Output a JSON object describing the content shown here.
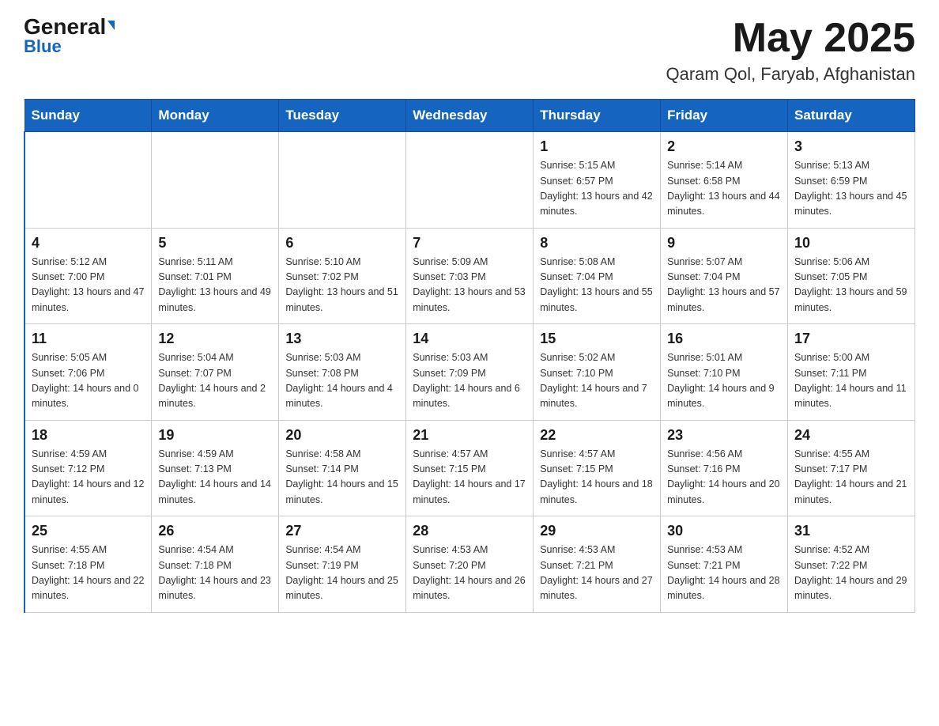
{
  "header": {
    "logo_general": "General",
    "logo_blue": "Blue",
    "month_year": "May 2025",
    "location": "Qaram Qol, Faryab, Afghanistan"
  },
  "days_of_week": [
    "Sunday",
    "Monday",
    "Tuesday",
    "Wednesday",
    "Thursday",
    "Friday",
    "Saturday"
  ],
  "weeks": [
    [
      {
        "day": "",
        "info": ""
      },
      {
        "day": "",
        "info": ""
      },
      {
        "day": "",
        "info": ""
      },
      {
        "day": "",
        "info": ""
      },
      {
        "day": "1",
        "info": "Sunrise: 5:15 AM\nSunset: 6:57 PM\nDaylight: 13 hours and 42 minutes."
      },
      {
        "day": "2",
        "info": "Sunrise: 5:14 AM\nSunset: 6:58 PM\nDaylight: 13 hours and 44 minutes."
      },
      {
        "day": "3",
        "info": "Sunrise: 5:13 AM\nSunset: 6:59 PM\nDaylight: 13 hours and 45 minutes."
      }
    ],
    [
      {
        "day": "4",
        "info": "Sunrise: 5:12 AM\nSunset: 7:00 PM\nDaylight: 13 hours and 47 minutes."
      },
      {
        "day": "5",
        "info": "Sunrise: 5:11 AM\nSunset: 7:01 PM\nDaylight: 13 hours and 49 minutes."
      },
      {
        "day": "6",
        "info": "Sunrise: 5:10 AM\nSunset: 7:02 PM\nDaylight: 13 hours and 51 minutes."
      },
      {
        "day": "7",
        "info": "Sunrise: 5:09 AM\nSunset: 7:03 PM\nDaylight: 13 hours and 53 minutes."
      },
      {
        "day": "8",
        "info": "Sunrise: 5:08 AM\nSunset: 7:04 PM\nDaylight: 13 hours and 55 minutes."
      },
      {
        "day": "9",
        "info": "Sunrise: 5:07 AM\nSunset: 7:04 PM\nDaylight: 13 hours and 57 minutes."
      },
      {
        "day": "10",
        "info": "Sunrise: 5:06 AM\nSunset: 7:05 PM\nDaylight: 13 hours and 59 minutes."
      }
    ],
    [
      {
        "day": "11",
        "info": "Sunrise: 5:05 AM\nSunset: 7:06 PM\nDaylight: 14 hours and 0 minutes."
      },
      {
        "day": "12",
        "info": "Sunrise: 5:04 AM\nSunset: 7:07 PM\nDaylight: 14 hours and 2 minutes."
      },
      {
        "day": "13",
        "info": "Sunrise: 5:03 AM\nSunset: 7:08 PM\nDaylight: 14 hours and 4 minutes."
      },
      {
        "day": "14",
        "info": "Sunrise: 5:03 AM\nSunset: 7:09 PM\nDaylight: 14 hours and 6 minutes."
      },
      {
        "day": "15",
        "info": "Sunrise: 5:02 AM\nSunset: 7:10 PM\nDaylight: 14 hours and 7 minutes."
      },
      {
        "day": "16",
        "info": "Sunrise: 5:01 AM\nSunset: 7:10 PM\nDaylight: 14 hours and 9 minutes."
      },
      {
        "day": "17",
        "info": "Sunrise: 5:00 AM\nSunset: 7:11 PM\nDaylight: 14 hours and 11 minutes."
      }
    ],
    [
      {
        "day": "18",
        "info": "Sunrise: 4:59 AM\nSunset: 7:12 PM\nDaylight: 14 hours and 12 minutes."
      },
      {
        "day": "19",
        "info": "Sunrise: 4:59 AM\nSunset: 7:13 PM\nDaylight: 14 hours and 14 minutes."
      },
      {
        "day": "20",
        "info": "Sunrise: 4:58 AM\nSunset: 7:14 PM\nDaylight: 14 hours and 15 minutes."
      },
      {
        "day": "21",
        "info": "Sunrise: 4:57 AM\nSunset: 7:15 PM\nDaylight: 14 hours and 17 minutes."
      },
      {
        "day": "22",
        "info": "Sunrise: 4:57 AM\nSunset: 7:15 PM\nDaylight: 14 hours and 18 minutes."
      },
      {
        "day": "23",
        "info": "Sunrise: 4:56 AM\nSunset: 7:16 PM\nDaylight: 14 hours and 20 minutes."
      },
      {
        "day": "24",
        "info": "Sunrise: 4:55 AM\nSunset: 7:17 PM\nDaylight: 14 hours and 21 minutes."
      }
    ],
    [
      {
        "day": "25",
        "info": "Sunrise: 4:55 AM\nSunset: 7:18 PM\nDaylight: 14 hours and 22 minutes."
      },
      {
        "day": "26",
        "info": "Sunrise: 4:54 AM\nSunset: 7:18 PM\nDaylight: 14 hours and 23 minutes."
      },
      {
        "day": "27",
        "info": "Sunrise: 4:54 AM\nSunset: 7:19 PM\nDaylight: 14 hours and 25 minutes."
      },
      {
        "day": "28",
        "info": "Sunrise: 4:53 AM\nSunset: 7:20 PM\nDaylight: 14 hours and 26 minutes."
      },
      {
        "day": "29",
        "info": "Sunrise: 4:53 AM\nSunset: 7:21 PM\nDaylight: 14 hours and 27 minutes."
      },
      {
        "day": "30",
        "info": "Sunrise: 4:53 AM\nSunset: 7:21 PM\nDaylight: 14 hours and 28 minutes."
      },
      {
        "day": "31",
        "info": "Sunrise: 4:52 AM\nSunset: 7:22 PM\nDaylight: 14 hours and 29 minutes."
      }
    ]
  ]
}
